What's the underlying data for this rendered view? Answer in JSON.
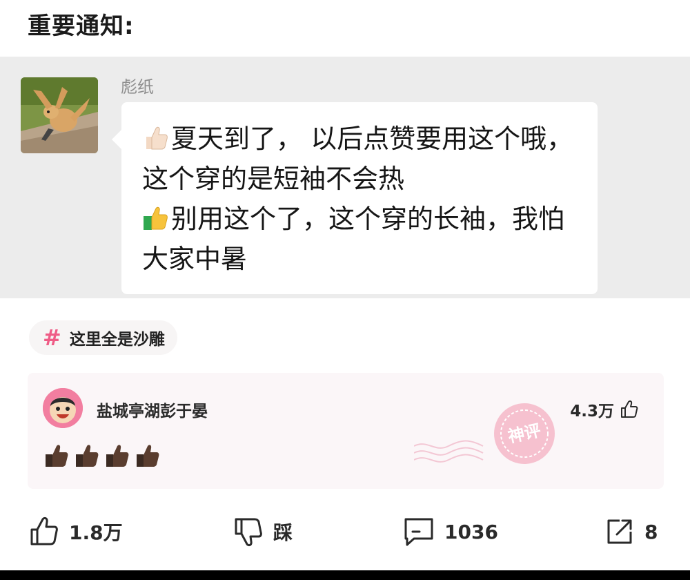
{
  "heading": "重要通知:",
  "message": {
    "sender": "彪纸",
    "line1_text": "夏天到了， 以后点赞要用这个哦，这个穿的是短袖不会热",
    "line2_text": "别用这个了，这个穿的长袖，我怕大家中暑",
    "icons": [
      "light-thumbs-up-icon",
      "green-sleeve-thumbs-up-icon"
    ]
  },
  "topic": {
    "icon": "#",
    "label": "这里全是沙雕"
  },
  "god_comment": {
    "username": "盐城亭湖彭于晏",
    "likes": "4.3万",
    "stamp_label": "神评",
    "body_icons": [
      "dark-thumbs-up-icon",
      "dark-thumbs-up-icon",
      "dark-thumbs-up-icon",
      "dark-thumbs-up-icon"
    ]
  },
  "actions": {
    "like_count": "1.8万",
    "dislike_label": "踩",
    "comment_count": "1036",
    "share_count": "8"
  },
  "colors": {
    "accent_pink": "#ef5c86",
    "chat_bg": "#ececec",
    "comment_bg": "#fbf6f8"
  }
}
